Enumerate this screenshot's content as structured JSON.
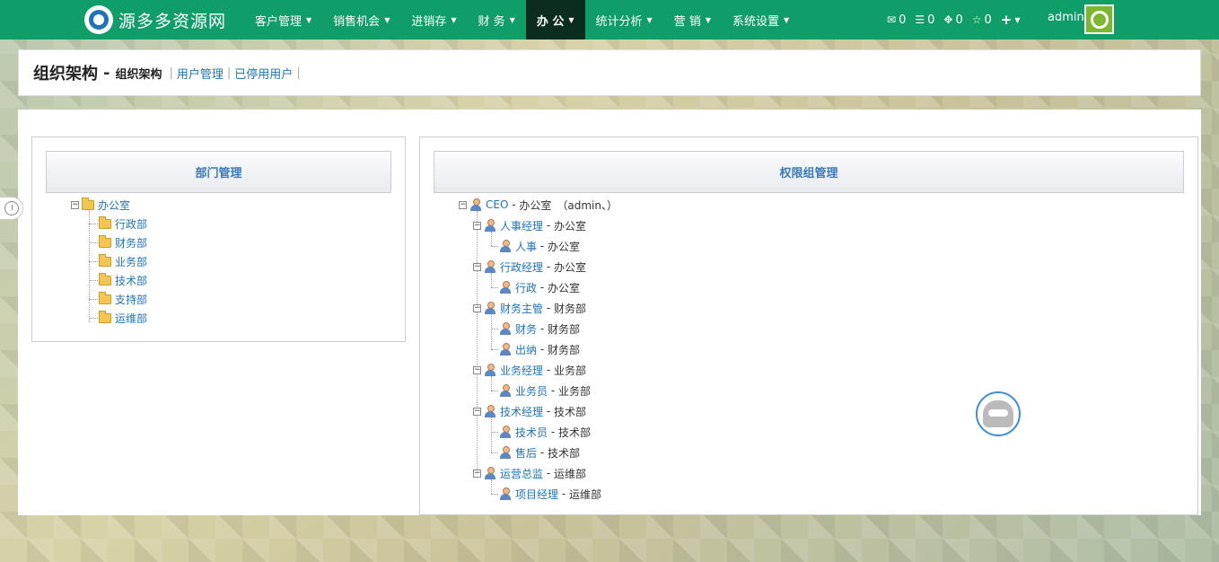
{
  "brand": {
    "name": "源多多资源网"
  },
  "nav": {
    "items": [
      {
        "label": "客户管理",
        "active": false
      },
      {
        "label": "销售机会",
        "active": false
      },
      {
        "label": "进销存",
        "active": false
      },
      {
        "label": "财 务",
        "active": false
      },
      {
        "label": "办 公",
        "active": true
      },
      {
        "label": "统计分析",
        "active": false
      },
      {
        "label": "营 销",
        "active": false
      },
      {
        "label": "系统设置",
        "active": false
      }
    ],
    "tools": {
      "mail_count": "0",
      "task_count": "0",
      "share_count": "0",
      "star_count": "0"
    },
    "user": "admin"
  },
  "header": {
    "title": "组织架构",
    "separator": "-",
    "current": "组织架构",
    "links": [
      "用户管理",
      "已停用用户"
    ]
  },
  "dept_panel": {
    "title": "部门管理",
    "root": "办公室",
    "children": [
      "行政部",
      "财务部",
      "业务部",
      "技术部",
      "支持部",
      "运维部"
    ]
  },
  "role_panel": {
    "title": "权限组管理",
    "nodes": [
      {
        "name": "CEO",
        "dept": "办公室",
        "extra": "（admin、）",
        "level": 0
      },
      {
        "name": "人事经理",
        "dept": "办公室",
        "level": 1
      },
      {
        "name": "人事",
        "dept": "办公室",
        "level": 2
      },
      {
        "name": "行政经理",
        "dept": "办公室",
        "level": 1
      },
      {
        "name": "行政",
        "dept": "办公室",
        "level": 2
      },
      {
        "name": "财务主管",
        "dept": "财务部",
        "level": 1
      },
      {
        "name": "财务",
        "dept": "财务部",
        "level": 2
      },
      {
        "name": "出纳",
        "dept": "财务部",
        "level": 2
      },
      {
        "name": "业务经理",
        "dept": "业务部",
        "level": 1
      },
      {
        "name": "业务员",
        "dept": "业务部",
        "level": 2
      },
      {
        "name": "技术经理",
        "dept": "技术部",
        "level": 1
      },
      {
        "name": "技术员",
        "dept": "技术部",
        "level": 2
      },
      {
        "name": "售后",
        "dept": "技术部",
        "level": 2
      },
      {
        "name": "运营总监",
        "dept": "运维部",
        "level": 1
      },
      {
        "name": "项目经理",
        "dept": "运维部",
        "level": 2
      }
    ]
  },
  "colors": {
    "nav_bg": "#0f9e6a",
    "nav_active": "#0b2d1f",
    "link": "#1e74b9"
  }
}
